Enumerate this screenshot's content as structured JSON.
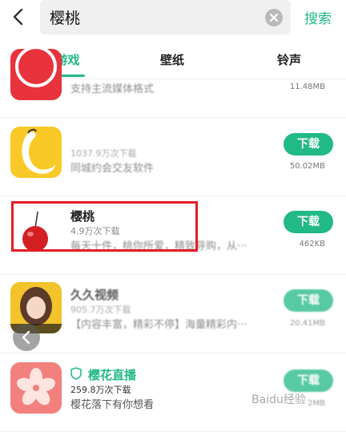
{
  "header": {
    "search_value": "樱桃",
    "search_button": "搜索"
  },
  "tabs": [
    {
      "label": "软件/游戏",
      "active": true
    },
    {
      "label": "壁纸",
      "active": false
    },
    {
      "label": "铃声",
      "active": false
    }
  ],
  "list": [
    {
      "name": "",
      "downloads": "",
      "description": "支持主流媒体格式",
      "size": "11.48MB",
      "button": ""
    },
    {
      "name": "",
      "downloads": "1037.9万次下载",
      "description": "同城约会交友软件",
      "size": "50.02MB",
      "button": "下载"
    },
    {
      "name": "樱桃",
      "downloads": "4.9万次下载",
      "description": "每天十件，桃你所爱，精致导购，从···",
      "size": "462KB",
      "button": "下载"
    },
    {
      "name": "久久视频",
      "downloads": "905.7万次下载",
      "description": "【内容丰富，精彩不停】海量精彩内···",
      "size": "20.41MB",
      "button": "下载"
    },
    {
      "name": "樱花直播",
      "downloads": "259.8万次下载",
      "description": "樱花落下有你想看",
      "size": "2MB",
      "button": "下载"
    }
  ],
  "watermark": "Baidu经验",
  "accent_color": "#21b985",
  "highlight_color": "#e41c25"
}
